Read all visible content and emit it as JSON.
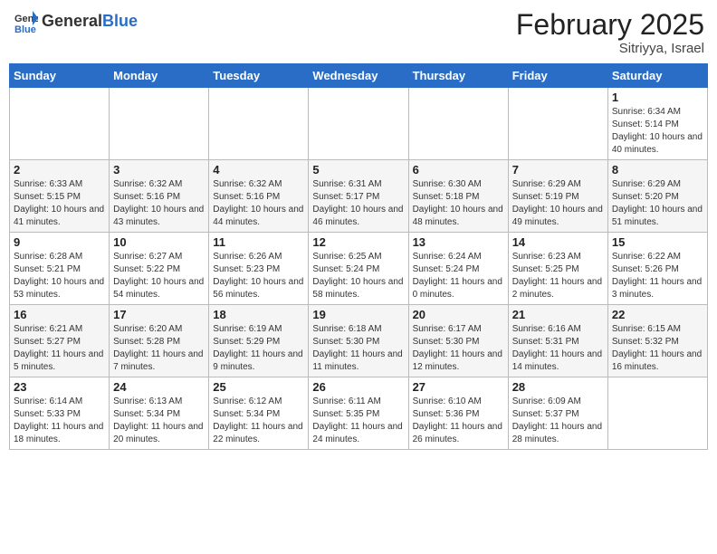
{
  "header": {
    "logo_general": "General",
    "logo_blue": "Blue",
    "month": "February 2025",
    "location": "Sitriyya, Israel"
  },
  "weekdays": [
    "Sunday",
    "Monday",
    "Tuesday",
    "Wednesday",
    "Thursday",
    "Friday",
    "Saturday"
  ],
  "weeks": [
    [
      {
        "day": "",
        "info": ""
      },
      {
        "day": "",
        "info": ""
      },
      {
        "day": "",
        "info": ""
      },
      {
        "day": "",
        "info": ""
      },
      {
        "day": "",
        "info": ""
      },
      {
        "day": "",
        "info": ""
      },
      {
        "day": "1",
        "info": "Sunrise: 6:34 AM\nSunset: 5:14 PM\nDaylight: 10 hours and 40 minutes."
      }
    ],
    [
      {
        "day": "2",
        "info": "Sunrise: 6:33 AM\nSunset: 5:15 PM\nDaylight: 10 hours and 41 minutes."
      },
      {
        "day": "3",
        "info": "Sunrise: 6:32 AM\nSunset: 5:16 PM\nDaylight: 10 hours and 43 minutes."
      },
      {
        "day": "4",
        "info": "Sunrise: 6:32 AM\nSunset: 5:16 PM\nDaylight: 10 hours and 44 minutes."
      },
      {
        "day": "5",
        "info": "Sunrise: 6:31 AM\nSunset: 5:17 PM\nDaylight: 10 hours and 46 minutes."
      },
      {
        "day": "6",
        "info": "Sunrise: 6:30 AM\nSunset: 5:18 PM\nDaylight: 10 hours and 48 minutes."
      },
      {
        "day": "7",
        "info": "Sunrise: 6:29 AM\nSunset: 5:19 PM\nDaylight: 10 hours and 49 minutes."
      },
      {
        "day": "8",
        "info": "Sunrise: 6:29 AM\nSunset: 5:20 PM\nDaylight: 10 hours and 51 minutes."
      }
    ],
    [
      {
        "day": "9",
        "info": "Sunrise: 6:28 AM\nSunset: 5:21 PM\nDaylight: 10 hours and 53 minutes."
      },
      {
        "day": "10",
        "info": "Sunrise: 6:27 AM\nSunset: 5:22 PM\nDaylight: 10 hours and 54 minutes."
      },
      {
        "day": "11",
        "info": "Sunrise: 6:26 AM\nSunset: 5:23 PM\nDaylight: 10 hours and 56 minutes."
      },
      {
        "day": "12",
        "info": "Sunrise: 6:25 AM\nSunset: 5:24 PM\nDaylight: 10 hours and 58 minutes."
      },
      {
        "day": "13",
        "info": "Sunrise: 6:24 AM\nSunset: 5:24 PM\nDaylight: 11 hours and 0 minutes."
      },
      {
        "day": "14",
        "info": "Sunrise: 6:23 AM\nSunset: 5:25 PM\nDaylight: 11 hours and 2 minutes."
      },
      {
        "day": "15",
        "info": "Sunrise: 6:22 AM\nSunset: 5:26 PM\nDaylight: 11 hours and 3 minutes."
      }
    ],
    [
      {
        "day": "16",
        "info": "Sunrise: 6:21 AM\nSunset: 5:27 PM\nDaylight: 11 hours and 5 minutes."
      },
      {
        "day": "17",
        "info": "Sunrise: 6:20 AM\nSunset: 5:28 PM\nDaylight: 11 hours and 7 minutes."
      },
      {
        "day": "18",
        "info": "Sunrise: 6:19 AM\nSunset: 5:29 PM\nDaylight: 11 hours and 9 minutes."
      },
      {
        "day": "19",
        "info": "Sunrise: 6:18 AM\nSunset: 5:30 PM\nDaylight: 11 hours and 11 minutes."
      },
      {
        "day": "20",
        "info": "Sunrise: 6:17 AM\nSunset: 5:30 PM\nDaylight: 11 hours and 12 minutes."
      },
      {
        "day": "21",
        "info": "Sunrise: 6:16 AM\nSunset: 5:31 PM\nDaylight: 11 hours and 14 minutes."
      },
      {
        "day": "22",
        "info": "Sunrise: 6:15 AM\nSunset: 5:32 PM\nDaylight: 11 hours and 16 minutes."
      }
    ],
    [
      {
        "day": "23",
        "info": "Sunrise: 6:14 AM\nSunset: 5:33 PM\nDaylight: 11 hours and 18 minutes."
      },
      {
        "day": "24",
        "info": "Sunrise: 6:13 AM\nSunset: 5:34 PM\nDaylight: 11 hours and 20 minutes."
      },
      {
        "day": "25",
        "info": "Sunrise: 6:12 AM\nSunset: 5:34 PM\nDaylight: 11 hours and 22 minutes."
      },
      {
        "day": "26",
        "info": "Sunrise: 6:11 AM\nSunset: 5:35 PM\nDaylight: 11 hours and 24 minutes."
      },
      {
        "day": "27",
        "info": "Sunrise: 6:10 AM\nSunset: 5:36 PM\nDaylight: 11 hours and 26 minutes."
      },
      {
        "day": "28",
        "info": "Sunrise: 6:09 AM\nSunset: 5:37 PM\nDaylight: 11 hours and 28 minutes."
      },
      {
        "day": "",
        "info": ""
      }
    ]
  ]
}
